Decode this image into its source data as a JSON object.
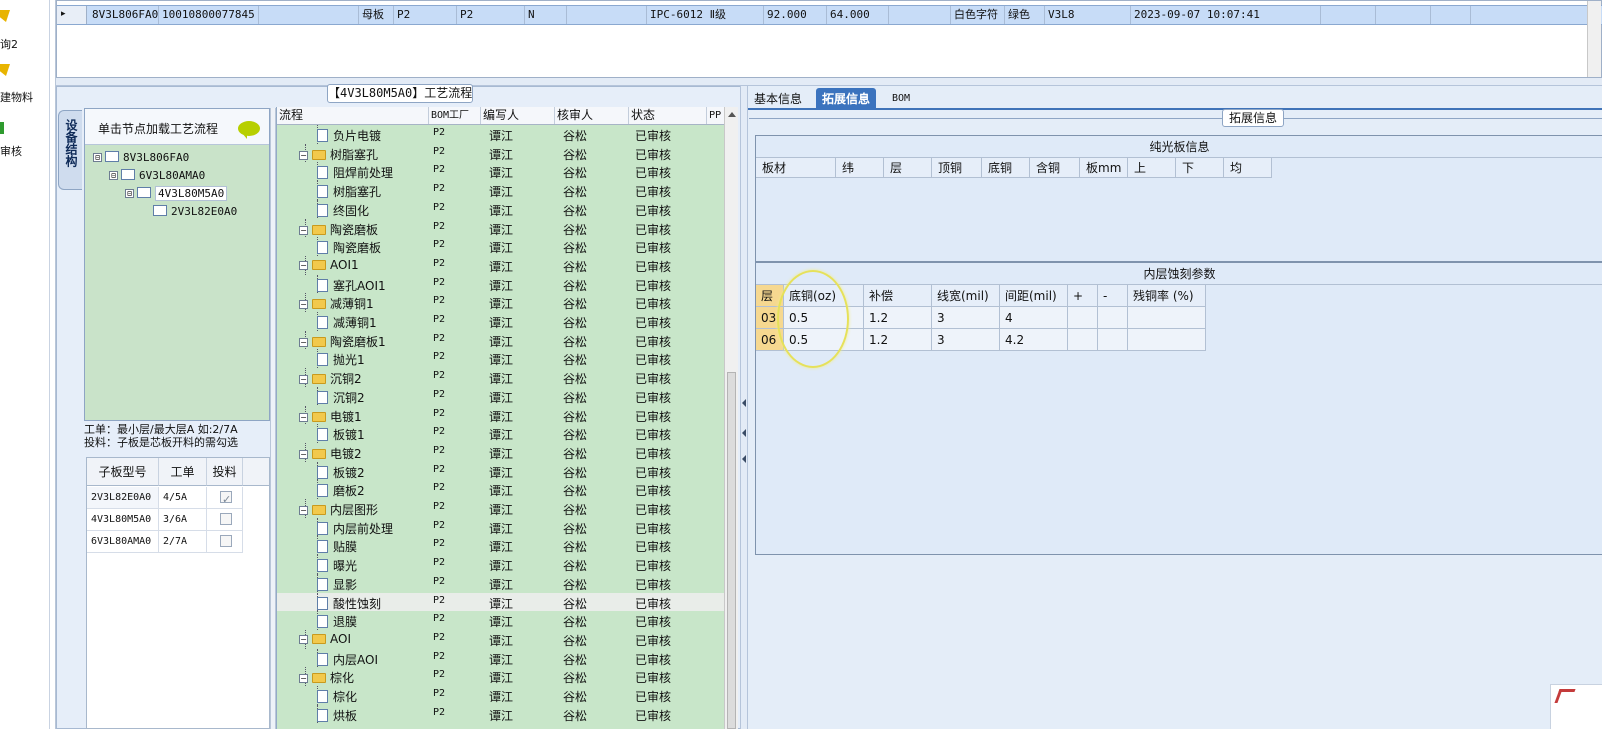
{
  "left_nav": [
    {
      "label": "询2",
      "icon": "folder-pen-icon",
      "color": "#e8b400"
    },
    {
      "label": "建物料",
      "icon": "folder-pen-icon",
      "color": "#e8b400"
    },
    {
      "label": "审核",
      "icon": "check-icon",
      "color": "#2f9b2f"
    }
  ],
  "top_row": {
    "arrow": "▸",
    "cells": [
      "8V3L806FA0",
      "10010800077845",
      "母板",
      "P2",
      "P2",
      "N",
      "IPC-6012 Ⅱ级",
      "92.000",
      "64.000",
      "白色字符",
      "绿色",
      "V3L8",
      "2023-09-07 10:07:41"
    ]
  },
  "flow_panel": {
    "title": "【4V3L80M5A0】工艺流程",
    "vertical_tab": "设备结构",
    "tree_header": "单击节点加载工艺流程",
    "tree": [
      {
        "label": "8V3L806FA0",
        "toggle": "⊟"
      },
      {
        "label": "6V3L80AMA0",
        "toggle": "⊟"
      },
      {
        "label": "4V3L80M5A0",
        "toggle": "⊟"
      },
      {
        "label": "2V3L82E0A0",
        "toggle": ""
      }
    ],
    "hint_line1": "工单：最小层/最大层A 如:2/7A",
    "hint_line2": "投料：子板是芯板开料的需勾选",
    "sub_table": {
      "headers": [
        "子板型号",
        "工单",
        "投料"
      ],
      "rows": [
        {
          "model": "2V3L82E0A0",
          "order": "4/5A",
          "feed": true
        },
        {
          "model": "4V3L80M5A0",
          "order": "3/6A",
          "feed": false
        },
        {
          "model": "6V3L80AMA0",
          "order": "2/7A",
          "feed": false
        }
      ]
    }
  },
  "process_table": {
    "headers": [
      "流程",
      "BOM工厂",
      "编写人",
      "核审人",
      "状态",
      "PP"
    ],
    "rows": [
      {
        "level": 1,
        "type": "leaf",
        "name": "负片电镀",
        "factory": "P2",
        "writer": "谭江",
        "reviewer": "谷松",
        "status": "已审核"
      },
      {
        "level": 0,
        "type": "group",
        "name": "树脂塞孔",
        "factory": "P2",
        "writer": "谭江",
        "reviewer": "谷松",
        "status": "已审核"
      },
      {
        "level": 1,
        "type": "leaf",
        "name": "阻焊前处理",
        "factory": "P2",
        "writer": "谭江",
        "reviewer": "谷松",
        "status": "已审核"
      },
      {
        "level": 1,
        "type": "leaf",
        "name": "树脂塞孔",
        "factory": "P2",
        "writer": "谭江",
        "reviewer": "谷松",
        "status": "已审核"
      },
      {
        "level": 1,
        "type": "leaf",
        "name": "终固化",
        "factory": "P2",
        "writer": "谭江",
        "reviewer": "谷松",
        "status": "已审核"
      },
      {
        "level": 0,
        "type": "group",
        "name": "陶瓷磨板",
        "factory": "P2",
        "writer": "谭江",
        "reviewer": "谷松",
        "status": "已审核"
      },
      {
        "level": 1,
        "type": "leaf",
        "name": "陶瓷磨板",
        "factory": "P2",
        "writer": "谭江",
        "reviewer": "谷松",
        "status": "已审核"
      },
      {
        "level": 0,
        "type": "group",
        "name": "AOI1",
        "factory": "P2",
        "writer": "谭江",
        "reviewer": "谷松",
        "status": "已审核"
      },
      {
        "level": 1,
        "type": "leaf",
        "name": "塞孔AOI1",
        "factory": "P2",
        "writer": "谭江",
        "reviewer": "谷松",
        "status": "已审核"
      },
      {
        "level": 0,
        "type": "group",
        "name": "减薄铜1",
        "factory": "P2",
        "writer": "谭江",
        "reviewer": "谷松",
        "status": "已审核"
      },
      {
        "level": 1,
        "type": "leaf",
        "name": "减薄铜1",
        "factory": "P2",
        "writer": "谭江",
        "reviewer": "谷松",
        "status": "已审核"
      },
      {
        "level": 0,
        "type": "group",
        "name": "陶瓷磨板1",
        "factory": "P2",
        "writer": "谭江",
        "reviewer": "谷松",
        "status": "已审核"
      },
      {
        "level": 1,
        "type": "leaf",
        "name": "抛光1",
        "factory": "P2",
        "writer": "谭江",
        "reviewer": "谷松",
        "status": "已审核"
      },
      {
        "level": 0,
        "type": "group",
        "name": "沉铜2",
        "factory": "P2",
        "writer": "谭江",
        "reviewer": "谷松",
        "status": "已审核"
      },
      {
        "level": 1,
        "type": "leaf",
        "name": "沉铜2",
        "factory": "P2",
        "writer": "谭江",
        "reviewer": "谷松",
        "status": "已审核"
      },
      {
        "level": 0,
        "type": "group",
        "name": "电镀1",
        "factory": "P2",
        "writer": "谭江",
        "reviewer": "谷松",
        "status": "已审核"
      },
      {
        "level": 1,
        "type": "leaf",
        "name": "板镀1",
        "factory": "P2",
        "writer": "谭江",
        "reviewer": "谷松",
        "status": "已审核"
      },
      {
        "level": 0,
        "type": "group",
        "name": "电镀2",
        "factory": "P2",
        "writer": "谭江",
        "reviewer": "谷松",
        "status": "已审核"
      },
      {
        "level": 1,
        "type": "leaf",
        "name": "板镀2",
        "factory": "P2",
        "writer": "谭江",
        "reviewer": "谷松",
        "status": "已审核"
      },
      {
        "level": 1,
        "type": "leaf",
        "name": "磨板2",
        "factory": "P2",
        "writer": "谭江",
        "reviewer": "谷松",
        "status": "已审核"
      },
      {
        "level": 0,
        "type": "group",
        "name": "内层图形",
        "factory": "P2",
        "writer": "谭江",
        "reviewer": "谷松",
        "status": "已审核"
      },
      {
        "level": 1,
        "type": "leaf",
        "name": "内层前处理",
        "factory": "P2",
        "writer": "谭江",
        "reviewer": "谷松",
        "status": "已审核"
      },
      {
        "level": 1,
        "type": "leaf",
        "name": "贴膜",
        "factory": "P2",
        "writer": "谭江",
        "reviewer": "谷松",
        "status": "已审核"
      },
      {
        "level": 1,
        "type": "leaf",
        "name": "曝光",
        "factory": "P2",
        "writer": "谭江",
        "reviewer": "谷松",
        "status": "已审核"
      },
      {
        "level": 1,
        "type": "leaf",
        "name": "显影",
        "factory": "P2",
        "writer": "谭江",
        "reviewer": "谷松",
        "status": "已审核"
      },
      {
        "level": 1,
        "type": "leaf",
        "name": "酸性蚀刻",
        "factory": "P2",
        "writer": "谭江",
        "reviewer": "谷松",
        "status": "已审核",
        "selected": true
      },
      {
        "level": 1,
        "type": "leaf",
        "name": "退膜",
        "factory": "P2",
        "writer": "谭江",
        "reviewer": "谷松",
        "status": "已审核"
      },
      {
        "level": 0,
        "type": "group",
        "name": "AOI",
        "factory": "P2",
        "writer": "谭江",
        "reviewer": "谷松",
        "status": "已审核"
      },
      {
        "level": 1,
        "type": "leaf",
        "name": "内层AOI",
        "factory": "P2",
        "writer": "谭江",
        "reviewer": "谷松",
        "status": "已审核"
      },
      {
        "level": 0,
        "type": "group",
        "name": "棕化",
        "factory": "P2",
        "writer": "谭江",
        "reviewer": "谷松",
        "status": "已审核"
      },
      {
        "level": 1,
        "type": "leaf",
        "name": "棕化",
        "factory": "P2",
        "writer": "谭江",
        "reviewer": "谷松",
        "status": "已审核"
      },
      {
        "level": 1,
        "type": "leaf",
        "name": "烘板",
        "factory": "P2",
        "writer": "谭江",
        "reviewer": "谷松",
        "status": "已审核"
      }
    ]
  },
  "right_panel": {
    "tabs": [
      {
        "label": "基本信息",
        "active": false
      },
      {
        "label": "拓展信息",
        "active": true
      },
      {
        "label": "BOM",
        "active": false
      }
    ],
    "section_title": "拓展信息",
    "plain_board": {
      "title": "纯光板信息",
      "headers": [
        "板材",
        "纬",
        "层",
        "顶铜",
        "底铜",
        "含铜",
        "板mm",
        "上",
        "下",
        "均"
      ]
    },
    "inner_etch": {
      "title": "内层蚀刻参数",
      "headers": [
        "层",
        "底铜(oz)",
        "补偿",
        "线宽(mil)",
        "间距(mil)",
        "+",
        "-",
        "残铜率 (%)"
      ],
      "rows": [
        [
          "03",
          "0.5",
          "1.2",
          "3",
          "4",
          "",
          "",
          ""
        ],
        [
          "06",
          "0.5",
          "1.2",
          "3",
          "4.2",
          "",
          "",
          ""
        ]
      ]
    }
  },
  "colors": {
    "top_row_selected": "#c7dcf7",
    "flow_green": "#c8e6c9",
    "tab_active": "#3b73be",
    "highlight": "#e6e15a"
  }
}
